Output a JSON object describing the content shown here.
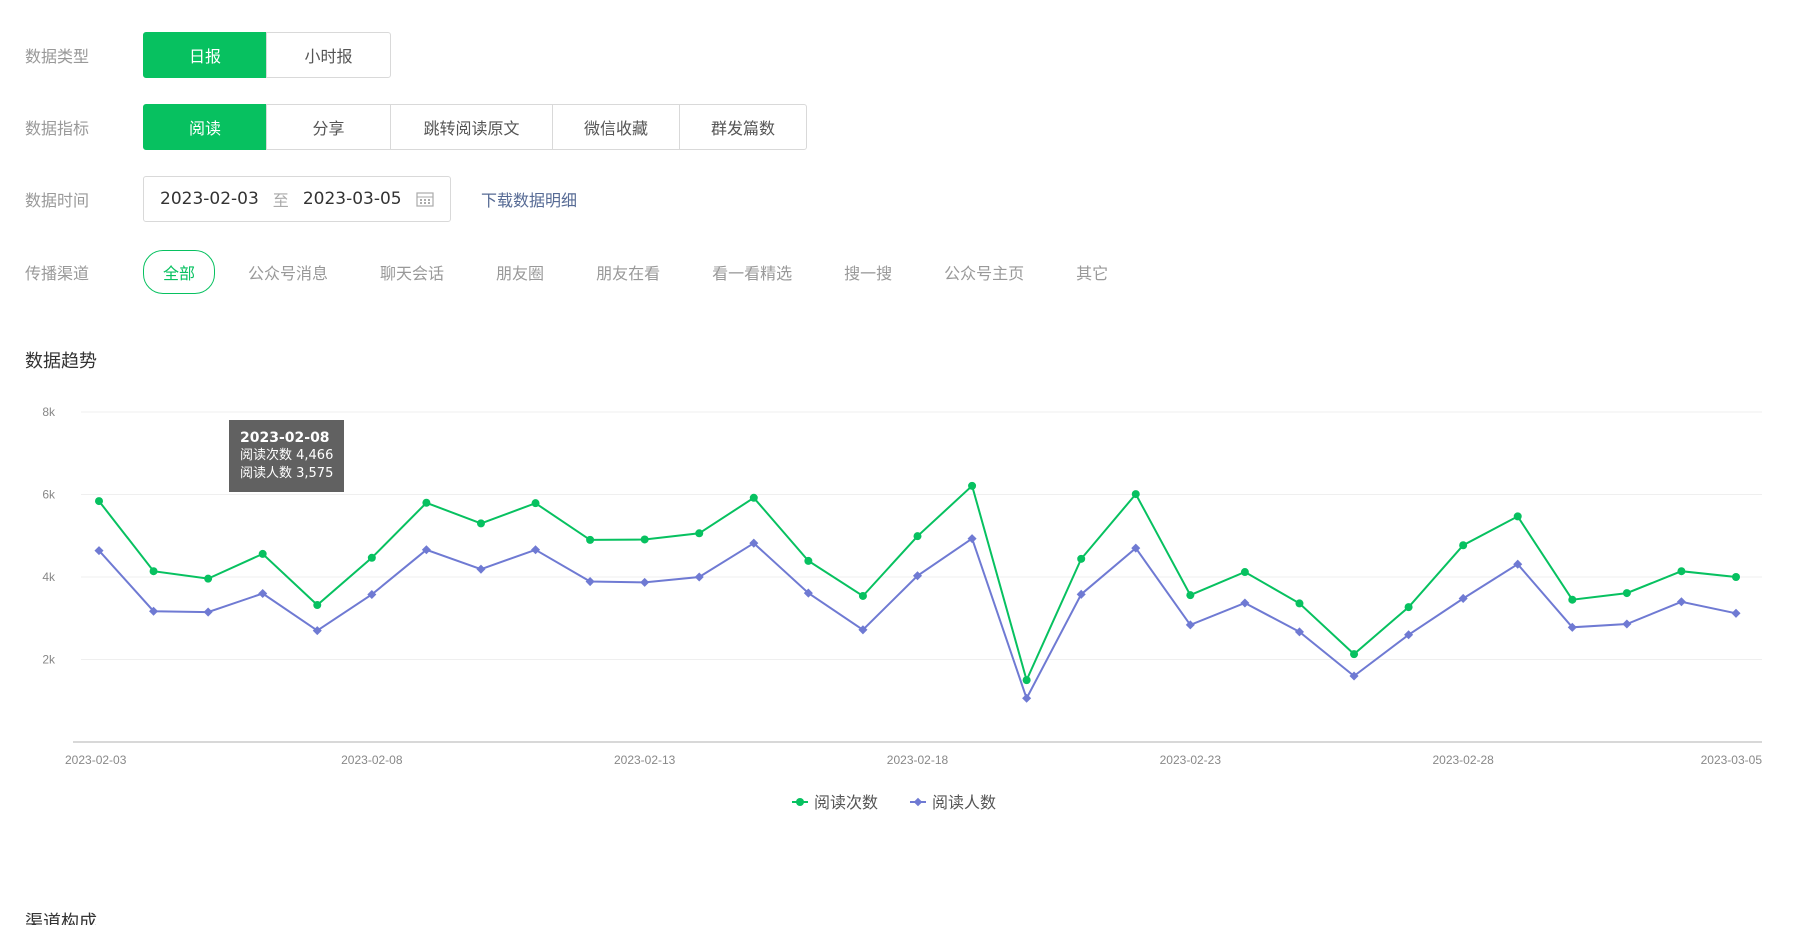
{
  "filters": {
    "type": {
      "label": "数据类型",
      "options": [
        "日报",
        "小时报"
      ],
      "active": 0
    },
    "metric": {
      "label": "数据指标",
      "options": [
        "阅读",
        "分享",
        "跳转阅读原文",
        "微信收藏",
        "群发篇数"
      ],
      "active": 0
    },
    "time": {
      "label": "数据时间",
      "start": "2023-02-03",
      "sep": "至",
      "end": "2023-03-05",
      "download": "下载数据明细"
    },
    "channel": {
      "label": "传播渠道",
      "options": [
        "全部",
        "公众号消息",
        "聊天会话",
        "朋友圈",
        "朋友在看",
        "看一看精选",
        "搜一搜",
        "公众号主页",
        "其它"
      ],
      "active": 0
    }
  },
  "trend_title": "数据趋势",
  "composition_title": "渠道构成",
  "tooltip": {
    "date": "2023-02-08",
    "line1": "阅读次数 4,466",
    "line2": "阅读人数 3,575"
  },
  "colors": {
    "accent": "#07c160",
    "series1": "#07c160",
    "series2": "#6f7ad3",
    "link": "#576b95"
  },
  "chart_data": {
    "type": "line",
    "x": [
      "2023-02-03",
      "2023-02-04",
      "2023-02-05",
      "2023-02-06",
      "2023-02-07",
      "2023-02-08",
      "2023-02-09",
      "2023-02-10",
      "2023-02-11",
      "2023-02-12",
      "2023-02-13",
      "2023-02-14",
      "2023-02-15",
      "2023-02-16",
      "2023-02-17",
      "2023-02-18",
      "2023-02-19",
      "2023-02-20",
      "2023-02-21",
      "2023-02-22",
      "2023-02-23",
      "2023-02-24",
      "2023-02-25",
      "2023-02-26",
      "2023-02-27",
      "2023-02-28",
      "2023-03-01",
      "2023-03-02",
      "2023-03-03",
      "2023-03-04",
      "2023-03-05"
    ],
    "x_tick_labels": [
      "2023-02-03",
      "2023-02-08",
      "2023-02-13",
      "2023-02-18",
      "2023-02-23",
      "2023-02-28",
      "2023-03-05"
    ],
    "y_tick_labels": [
      "2k",
      "4k",
      "6k",
      "8k"
    ],
    "y_ticks": [
      2000,
      4000,
      6000,
      8000
    ],
    "ylim": [
      0,
      8000
    ],
    "series": [
      {
        "name": "阅读次数",
        "values": [
          5840,
          4140,
          3960,
          4560,
          3320,
          4466,
          5800,
          5300,
          5790,
          4900,
          4910,
          5060,
          5920,
          4390,
          3540,
          4990,
          6210,
          1500,
          4440,
          6010,
          3560,
          4120,
          3360,
          2130,
          3270,
          4770,
          5470,
          3450,
          3610,
          4140,
          4000
        ]
      },
      {
        "name": "阅读人数",
        "values": [
          4640,
          3170,
          3150,
          3600,
          2700,
          3575,
          4660,
          4190,
          4660,
          3890,
          3870,
          4000,
          4820,
          3610,
          2720,
          4030,
          4930,
          1060,
          3580,
          4700,
          2840,
          3370,
          2670,
          1600,
          2600,
          3480,
          4310,
          2780,
          2860,
          3400,
          3120
        ]
      }
    ]
  }
}
